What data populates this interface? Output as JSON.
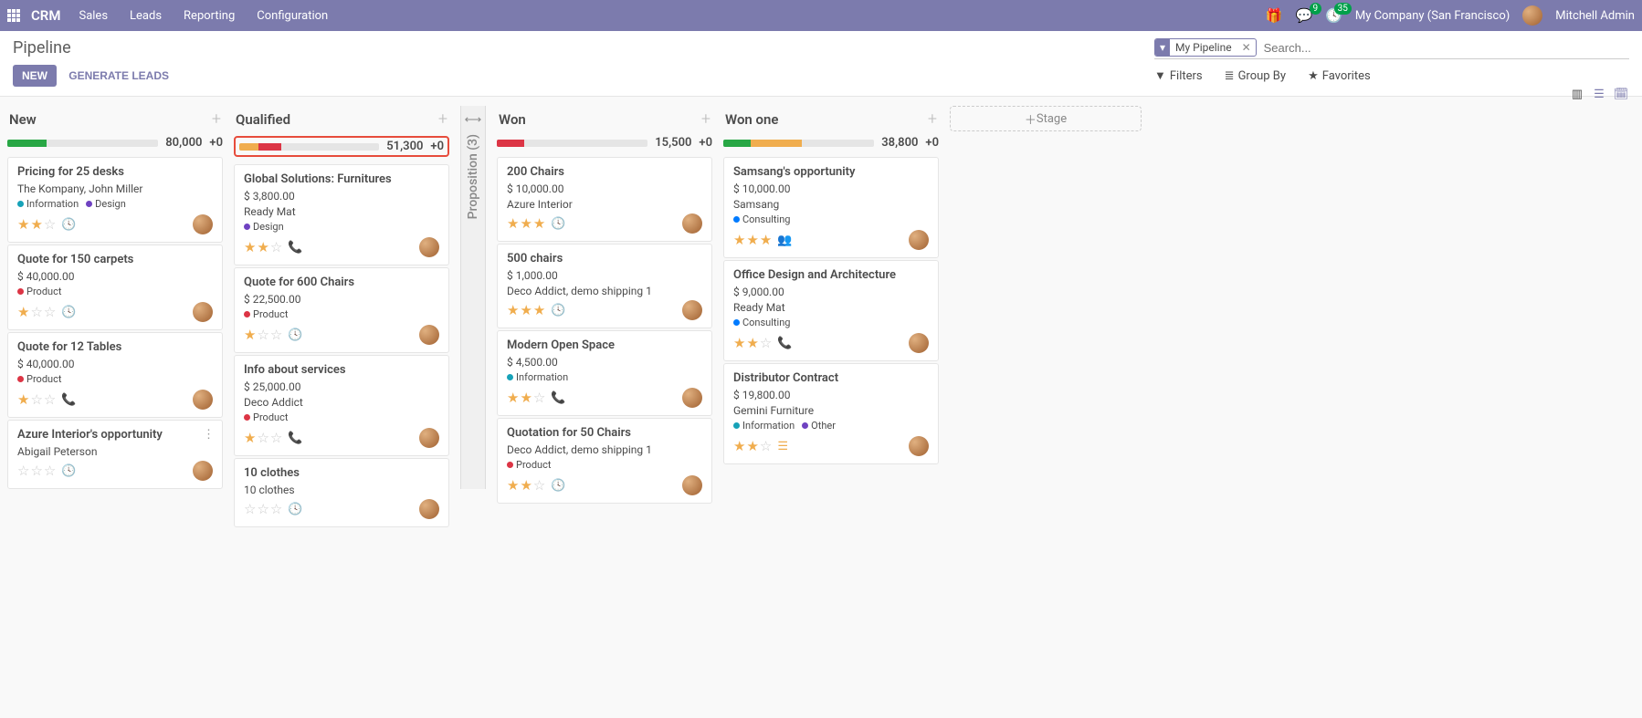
{
  "topnav": {
    "brand": "CRM",
    "menus": [
      "Sales",
      "Leads",
      "Reporting",
      "Configuration"
    ],
    "chat_badge": "9",
    "activity_badge": "35",
    "company": "My Company (San Francisco)",
    "user": "Mitchell Admin"
  },
  "controlbar": {
    "title": "Pipeline",
    "new_btn": "NEW",
    "generate_btn": "GENERATE LEADS",
    "facet_label": "My Pipeline",
    "search_placeholder": "Search...",
    "filters": "Filters",
    "group_by": "Group By",
    "favorites": "Favorites"
  },
  "folded": {
    "label": "Proposition (3)"
  },
  "add_stage": {
    "label": "Stage"
  },
  "columns": [
    {
      "title": "New",
      "amount": "80,000",
      "plus": "+0",
      "bar": [
        {
          "color": "#28a745",
          "w": 26
        }
      ],
      "highlighted": false,
      "cards": [
        {
          "title": "Pricing for 25 desks",
          "lines": [
            "The Kompany, John Miller"
          ],
          "tags": [
            {
              "color": "#17a2b8",
              "label": "Information"
            },
            {
              "color": "#6f42c1",
              "label": "Design"
            }
          ],
          "stars": 2,
          "icon": "clock"
        },
        {
          "title": "Quote for 150 carpets",
          "lines": [
            "$ 40,000.00"
          ],
          "tags": [
            {
              "color": "#dc3545",
              "label": "Product"
            }
          ],
          "stars": 1,
          "icon": "clock"
        },
        {
          "title": "Quote for 12 Tables",
          "lines": [
            "$ 40,000.00"
          ],
          "tags": [
            {
              "color": "#dc3545",
              "label": "Product"
            }
          ],
          "stars": 1,
          "icon": "phone-green"
        },
        {
          "title": "Azure Interior's opportunity",
          "lines": [
            "Abigail Peterson"
          ],
          "tags": [],
          "stars": 0,
          "icon": "clock",
          "more": true
        }
      ]
    },
    {
      "title": "Qualified",
      "amount": "51,300",
      "plus": "+0",
      "bar": [
        {
          "color": "#f0ad4e",
          "w": 14
        },
        {
          "color": "#dc3545",
          "w": 16
        }
      ],
      "highlighted": true,
      "cards": [
        {
          "title": "Global Solutions: Furnitures",
          "lines": [
            "$ 3,800.00",
            "Ready Mat"
          ],
          "tags": [
            {
              "color": "#6f42c1",
              "label": "Design"
            }
          ],
          "stars": 2,
          "icon": "phone-orange"
        },
        {
          "title": "Quote for 600 Chairs",
          "lines": [
            "$ 22,500.00"
          ],
          "tags": [
            {
              "color": "#dc3545",
              "label": "Product"
            }
          ],
          "stars": 1,
          "icon": "clock"
        },
        {
          "title": "Info about services",
          "lines": [
            "$ 25,000.00",
            "Deco Addict"
          ],
          "tags": [
            {
              "color": "#dc3545",
              "label": "Product"
            }
          ],
          "stars": 1,
          "icon": "phone-red"
        },
        {
          "title": "10 clothes",
          "lines": [
            "10 clothes"
          ],
          "tags": [],
          "stars": 0,
          "icon": "clock"
        }
      ]
    },
    {
      "title": "Won",
      "amount": "15,500",
      "plus": "+0",
      "bar": [
        {
          "color": "#dc3545",
          "w": 18
        }
      ],
      "highlighted": false,
      "cards": [
        {
          "title": "200 Chairs",
          "lines": [
            "$ 10,000.00",
            "Azure Interior"
          ],
          "tags": [],
          "stars": 3,
          "icon": "clock"
        },
        {
          "title": "500 chairs",
          "lines": [
            "$ 1,000.00",
            "Deco Addict, demo shipping 1"
          ],
          "tags": [],
          "stars": 3,
          "icon": "clock"
        },
        {
          "title": "Modern Open Space",
          "lines": [
            "$ 4,500.00"
          ],
          "tags": [
            {
              "color": "#17a2b8",
              "label": "Information"
            }
          ],
          "stars": 2,
          "icon": "phone-red"
        },
        {
          "title": "Quotation for 50 Chairs",
          "lines": [
            "Deco Addict, demo shipping 1"
          ],
          "tags": [
            {
              "color": "#dc3545",
              "label": "Product"
            }
          ],
          "stars": 2,
          "icon": "clock"
        }
      ]
    },
    {
      "title": "Won one",
      "amount": "38,800",
      "plus": "+0",
      "bar": [
        {
          "color": "#28a745",
          "w": 18
        },
        {
          "color": "#f0ad4e",
          "w": 34
        }
      ],
      "highlighted": false,
      "cards": [
        {
          "title": "Samsang's opportunity",
          "lines": [
            "$ 10,000.00",
            "Samsang"
          ],
          "tags": [
            {
              "color": "#007bff",
              "label": "Consulting"
            }
          ],
          "stars": 3,
          "icon": "users-orange"
        },
        {
          "title": "Office Design and Architecture",
          "lines": [
            "$ 9,000.00",
            "Ready Mat"
          ],
          "tags": [
            {
              "color": "#007bff",
              "label": "Consulting"
            }
          ],
          "stars": 2,
          "icon": "phone-green"
        },
        {
          "title": "Distributor Contract",
          "lines": [
            "$ 19,800.00",
            "Gemini Furniture"
          ],
          "tags": [
            {
              "color": "#17a2b8",
              "label": "Information"
            },
            {
              "color": "#6f42c1",
              "label": "Other"
            }
          ],
          "stars": 2,
          "icon": "list-orange"
        }
      ]
    }
  ]
}
